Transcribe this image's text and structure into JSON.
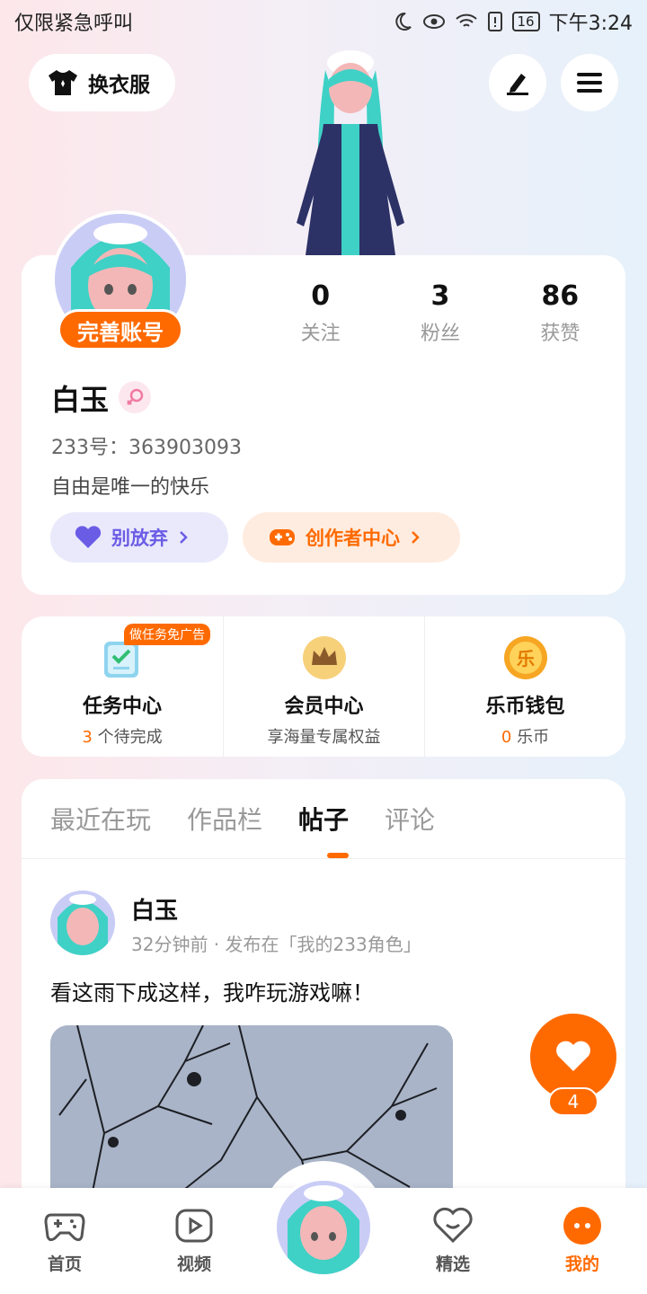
{
  "status_bar": {
    "left_text": "仅限紧急呼叫",
    "battery": "16",
    "time": "下午3:24"
  },
  "header": {
    "wardrobe_label": "换衣服",
    "icons": [
      "tshirt-icon",
      "pen-icon",
      "menu-icon"
    ]
  },
  "profile": {
    "complete_badge": "完善账号",
    "stats": [
      {
        "value": "0",
        "label": "关注"
      },
      {
        "value": "3",
        "label": "粉丝"
      },
      {
        "value": "86",
        "label": "获赞"
      }
    ],
    "nickname": "白玉",
    "gender": "female",
    "uid": "233号：363903093",
    "bio": "自由是唯一的快乐",
    "pill_1": "别放弃",
    "pill_2": "创作者中心"
  },
  "quick": {
    "task_tag": "做任务免广告",
    "items": [
      {
        "title": "任务中心",
        "count": "3",
        "sub": " 个待完成"
      },
      {
        "title": "会员中心",
        "sub": "享海量专属权益"
      },
      {
        "title": "乐币钱包",
        "count": "0",
        "sub": " 乐币",
        "icon_glyph": "乐"
      }
    ]
  },
  "tabs": {
    "items": [
      "最近在玩",
      "作品栏",
      "帖子",
      "评论"
    ],
    "active_index": 2
  },
  "post": {
    "author": "白玉",
    "meta": "32分钟前 · 发布在「我的233角色」",
    "text": "看这雨下成这样，我咋玩游戏嘛！"
  },
  "like": {
    "count": "4"
  },
  "bottom_nav": {
    "items": [
      "首页",
      "视频",
      "精选",
      "我的"
    ],
    "active": "我的"
  },
  "colors": {
    "accent": "#ff6a00",
    "purple": "#6b5ce6"
  }
}
